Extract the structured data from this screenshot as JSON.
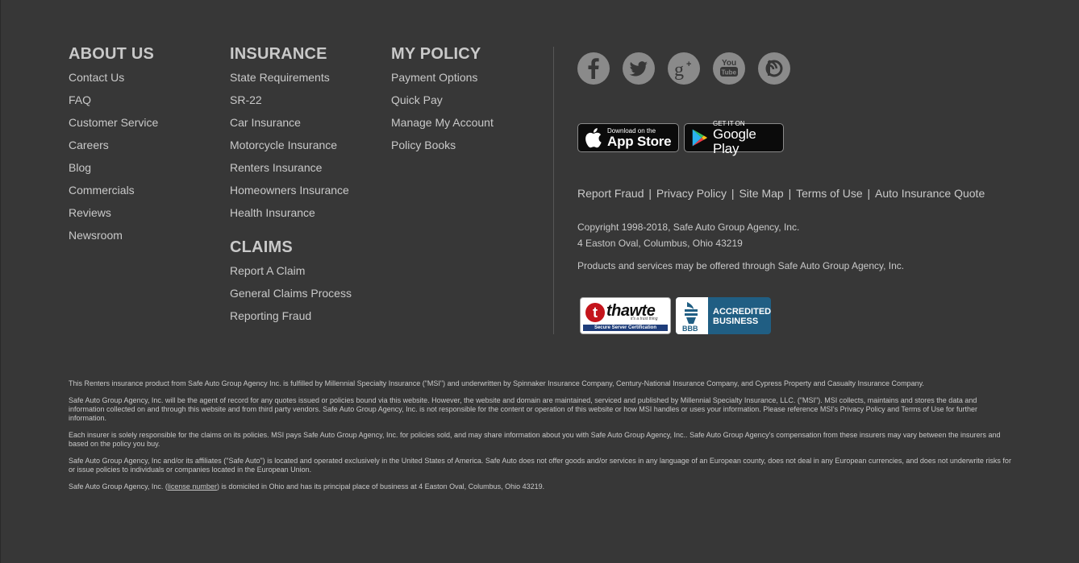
{
  "about": {
    "heading": "ABOUT US",
    "items": [
      "Contact Us",
      "FAQ",
      "Customer Service",
      "Careers",
      "Blog",
      "Commercials",
      "Reviews",
      "Newsroom"
    ]
  },
  "insurance": {
    "heading": "INSURANCE",
    "items": [
      "State Requirements",
      "SR-22",
      "Car Insurance",
      "Motorcycle Insurance",
      "Renters Insurance",
      "Homeowners Insurance",
      "Health Insurance"
    ]
  },
  "claims": {
    "heading": "CLAIMS",
    "items": [
      "Report A Claim",
      "General Claims Process",
      "Reporting Fraud"
    ]
  },
  "policy": {
    "heading": "MY POLICY",
    "items": [
      "Payment Options",
      "Quick Pay",
      "Manage My Account",
      "Policy Books"
    ]
  },
  "social": [
    "facebook-icon",
    "twitter-icon",
    "google-plus-icon",
    "youtube-icon",
    "blog-icon"
  ],
  "stores": {
    "apple_small": "Download on the",
    "apple_big": "App Store",
    "google_small": "GET IT ON",
    "google_big": "Google Play"
  },
  "legal_links": [
    "Report Fraud",
    "Privacy Policy",
    "Site Map",
    "Terms of Use",
    "Auto Insurance Quote"
  ],
  "copyright": "Copyright 1998-2018, Safe Auto Group Agency, Inc.",
  "address": "4 Easton Oval, Columbus, Ohio 43219",
  "offered": "Products and services may be offered through Safe Auto Group Agency, Inc.",
  "badges": {
    "thawte_word": "thawte",
    "thawte_tag": "it's a trust thing",
    "thawte_bar": "Secure Server Certification",
    "bbb_label": "BBB",
    "bbb_line1": "ACCREDITED",
    "bbb_line2": "BUSINESS"
  },
  "disclaimers": {
    "p1": "This Renters insurance product from Safe Auto Group Agency Inc. is fulfilled by Millennial Specialty Insurance (\"MSI\") and underwritten by Spinnaker Insurance Company, Century-National Insurance Company, and Cypress Property and Casualty Insurance Company.",
    "p2": "Safe Auto Group Agency, Inc. will be the agent of record for any quotes issued or policies bound via this website. However, the website and domain are maintained, serviced and published by Millennial Specialty Insurance, LLC. (\"MSI\"). MSI collects, maintains and stores the data and information collected on and through this website and from third party vendors. Safe Auto Group Agency, Inc. is not responsible for the content or operation of this website or how MSI handles or uses your information. Please reference MSI's Privacy Policy and Terms of Use for further information.",
    "p3": "Each insurer is solely responsible for the claims on its policies. MSI pays Safe Auto Group Agency, Inc. for policies sold, and may share information about you with Safe Auto Group Agency, Inc.. Safe Auto Group Agency's compensation from these insurers may vary between the insurers and based on the policy you buy.",
    "p4": "Safe Auto Group Agency, Inc and/or its affiliates (\"Safe Auto\") is located and operated exclusively in the United States of America. Safe Auto does not offer goods and/or services in any language of an European county, does not deal in any European currencies, and does not underwrite risks for or issue policies to individuals or companies located in the European Union.",
    "p5_pre": "Safe Auto Group Agency, Inc. (",
    "p5_link": "license number",
    "p5_post": ") is domiciled in Ohio and has its principal place of business at 4 Easton Oval, Columbus, Ohio 43219."
  }
}
